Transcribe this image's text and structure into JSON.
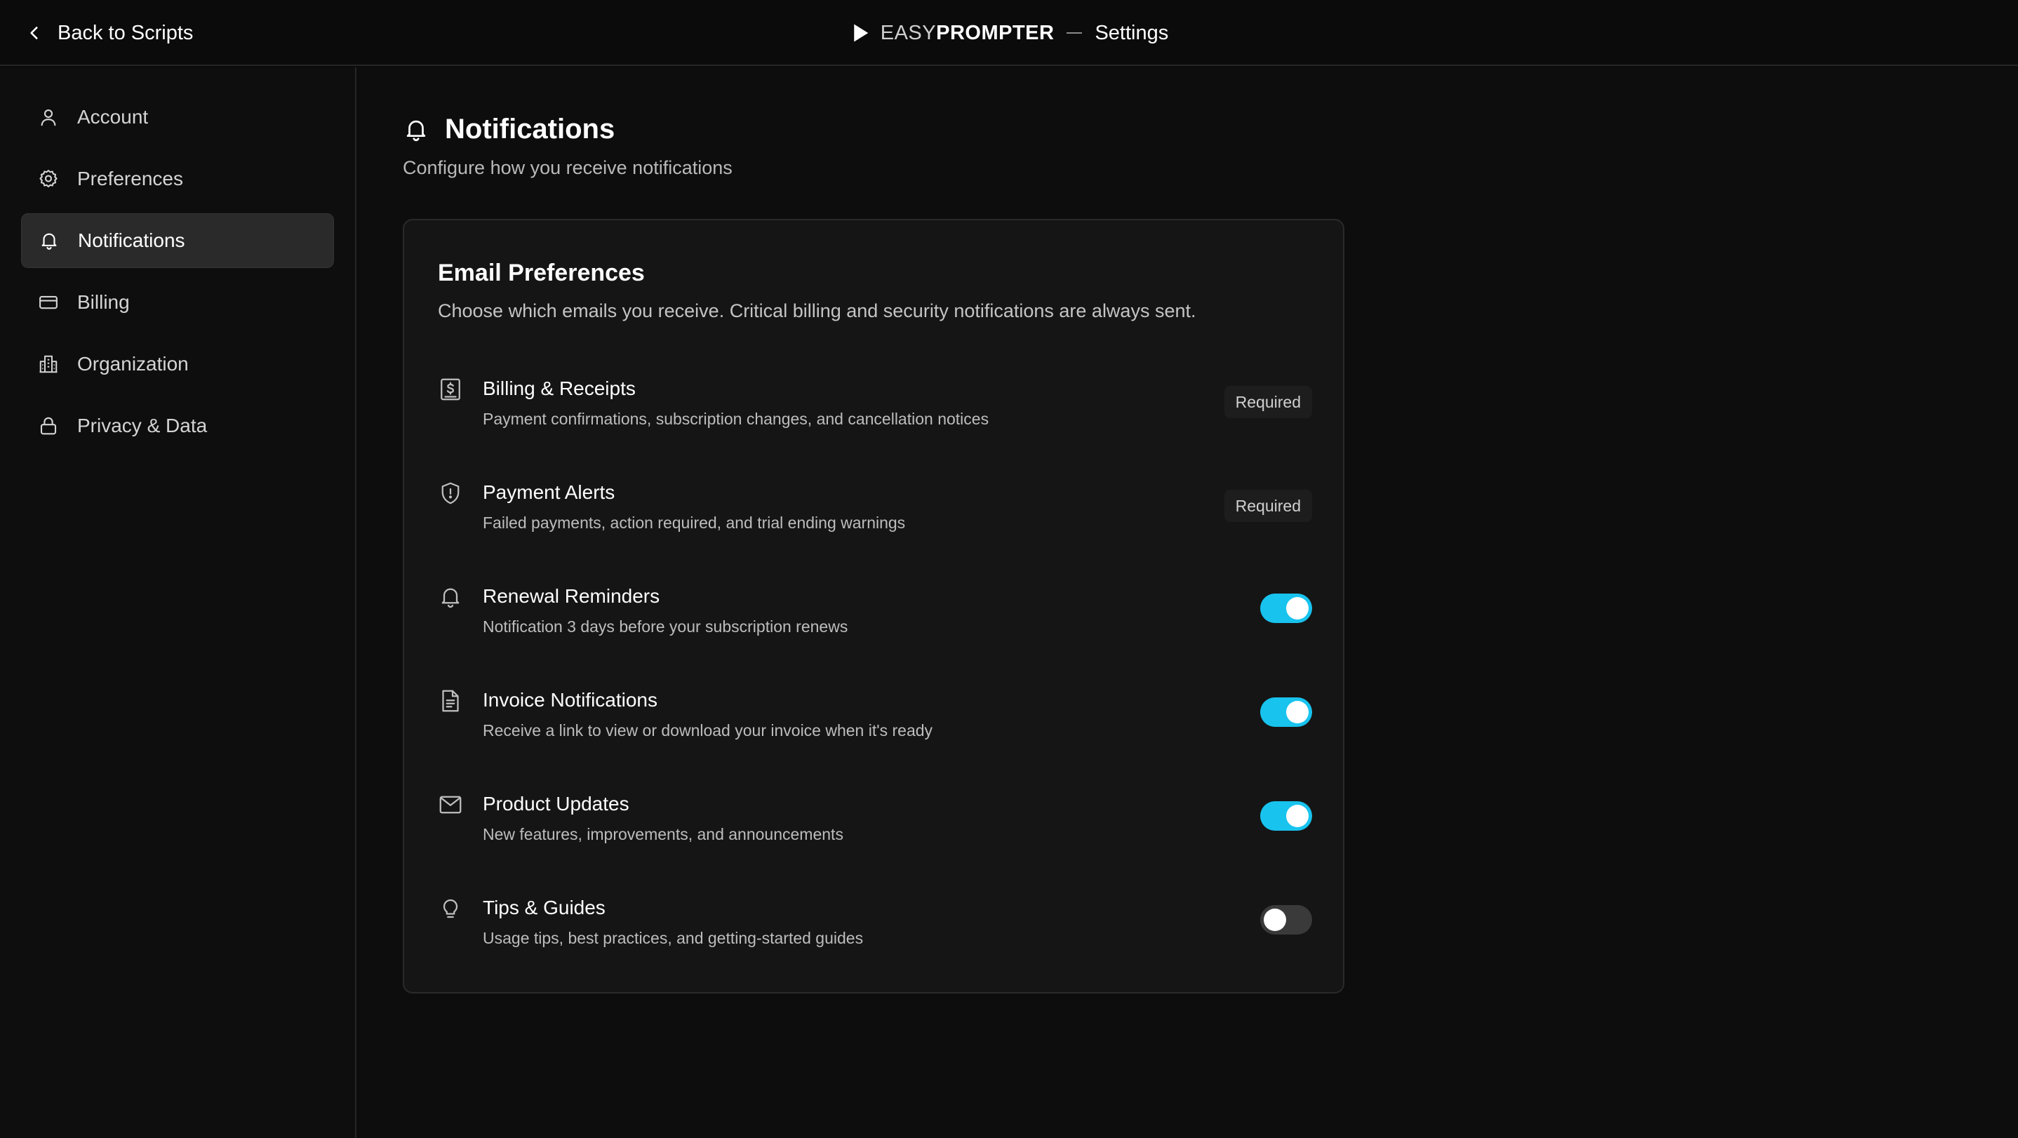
{
  "header": {
    "back_label": "Back to Scripts",
    "brand_easy": "EASY",
    "brand_prompter": "PROMPTER",
    "page_label": "Settings"
  },
  "sidebar": {
    "items": [
      {
        "label": "Account",
        "icon": "user-icon"
      },
      {
        "label": "Preferences",
        "icon": "gear-icon"
      },
      {
        "label": "Notifications",
        "icon": "bell-icon",
        "active": true
      },
      {
        "label": "Billing",
        "icon": "credit-card-icon"
      },
      {
        "label": "Organization",
        "icon": "building-icon"
      },
      {
        "label": "Privacy & Data",
        "icon": "lock-icon"
      }
    ]
  },
  "main": {
    "title": "Notifications",
    "subtitle": "Configure how you receive notifications",
    "card": {
      "title": "Email Preferences",
      "description": "Choose which emails you receive. Critical billing and security notifications are always sent.",
      "items": [
        {
          "title": "Billing & Receipts",
          "description": "Payment confirmations, subscription changes, and cancellation notices",
          "icon": "receipt-icon",
          "state": "required",
          "badge": "Required"
        },
        {
          "title": "Payment Alerts",
          "description": "Failed payments, action required, and trial ending warnings",
          "icon": "shield-alert-icon",
          "state": "required",
          "badge": "Required"
        },
        {
          "title": "Renewal Reminders",
          "description": "Notification 3 days before your subscription renews",
          "icon": "bell-icon",
          "state": "on"
        },
        {
          "title": "Invoice Notifications",
          "description": "Receive a link to view or download your invoice when it's ready",
          "icon": "file-text-icon",
          "state": "on"
        },
        {
          "title": "Product Updates",
          "description": "New features, improvements, and announcements",
          "icon": "mail-icon",
          "state": "on"
        },
        {
          "title": "Tips & Guides",
          "description": "Usage tips, best practices, and getting-started guides",
          "icon": "lightbulb-icon",
          "state": "off"
        }
      ]
    }
  },
  "colors": {
    "accent": "#18c3ee",
    "background": "#0c0c0c",
    "card": "#151515",
    "toggle_off": "#3a3a3a"
  }
}
